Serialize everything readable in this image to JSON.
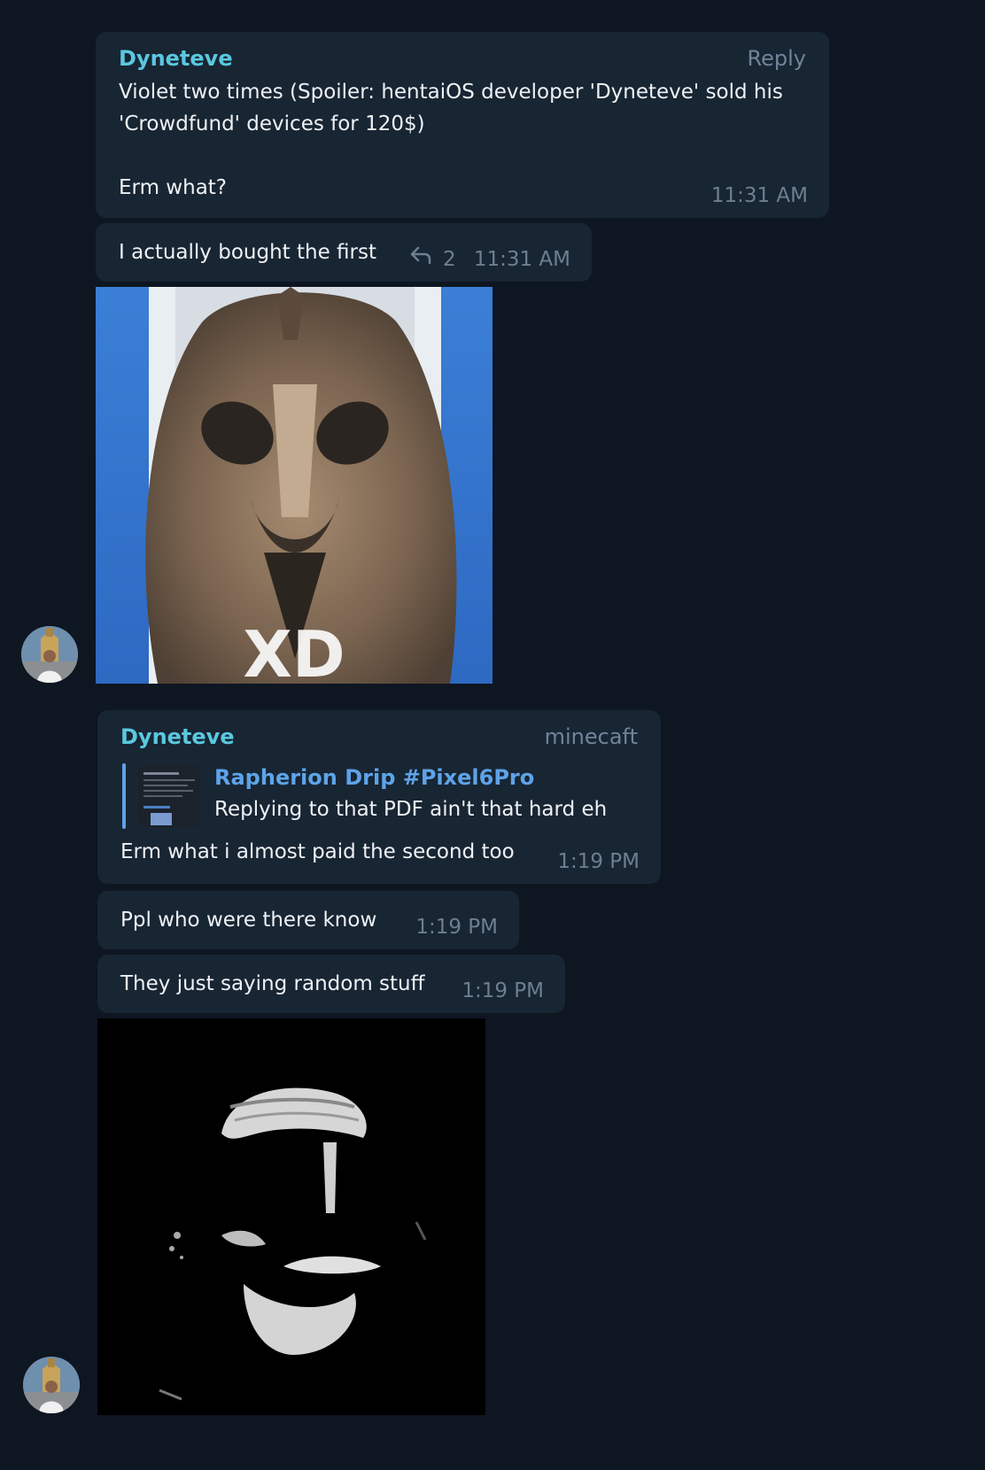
{
  "messages": {
    "m1": {
      "sender": "Dyneteve",
      "reply_label": "Reply",
      "line1": "Violet two times (Spoiler: hentaiOS developer 'Dyneteve' sold his",
      "line2": "'Crowdfund' devices for 120$)",
      "line3": "Erm what?",
      "time": "11:31 AM"
    },
    "m2": {
      "text": "I actually bought the first",
      "reply_count": "2",
      "time": "11:31 AM"
    },
    "m3": {
      "overlay_text": "XD"
    },
    "m4": {
      "sender": "Dyneteve",
      "tag": "minecaft",
      "quote_title": "Rapherion Drip #Pixel6Pro",
      "quote_text": "Replying to that PDF ain't that hard eh",
      "text": "Erm what i almost paid the second too",
      "time": "1:19 PM"
    },
    "m5": {
      "text": "Ppl who were there know",
      "time": "1:19 PM"
    },
    "m6": {
      "text": "They just saying random stuff",
      "time": "1:19 PM"
    }
  },
  "colors": {
    "background": "#0e1621",
    "bubble": "#182533",
    "sender_name": "#5ac8e0",
    "quote_accent": "#5ea3e8",
    "timestamp": "#6d7f91"
  },
  "icons": {
    "reply_icon": "reply-arrow-icon",
    "avatar": "user-avatar"
  }
}
